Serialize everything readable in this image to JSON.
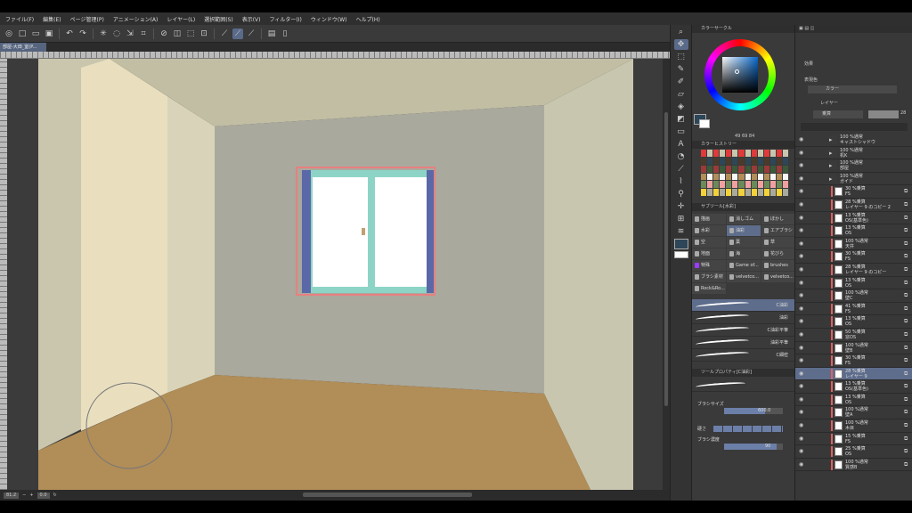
{
  "menu": [
    "ファイル(F)",
    "編集(E)",
    "ページ管理(P)",
    "アニメーション(A)",
    "レイヤー(L)",
    "選択範囲(S)",
    "表示(V)",
    "フィルター(I)",
    "ウィンドウ(W)",
    "ヘルプ(H)"
  ],
  "document_tab": "部屋-大田_室(P...",
  "status": {
    "zoom": "81.2",
    "angle": "0.0"
  },
  "panels": {
    "color_circle_title": "カラーサークル",
    "color_values": "49  69  84",
    "color_history_title": "カラーヒストリー",
    "subtool_title": "サブツール[水彩]",
    "tool_property_title": "ツールプロパティ[C油彩]",
    "effect_label": "効果",
    "display_color_label": "表現色",
    "display_color_value": "カラー",
    "layer_tab": "レイヤー",
    "blend_mode": "乗算",
    "opacity": "28"
  },
  "subtool_tabs": [
    "描画",
    "消しゴム",
    "ぼかし",
    "水彩",
    "油彩",
    "エアブラシ",
    "空",
    "葉",
    "草",
    "地面",
    "海",
    "花びら",
    "特殊",
    "Game of...",
    "brushes",
    "ブラシ素材",
    "velvetco...",
    "velvetco...",
    "Rock&Ro..."
  ],
  "brushes": [
    "C油彩",
    "油彩",
    "C油彩平筆",
    "油彩平筆",
    "C細密"
  ],
  "tool_props": {
    "brush_size_label": "ブラシサイズ",
    "brush_size_value": "600.0",
    "hardness_label": "硬さ",
    "density_label": "ブラシ濃度",
    "density_value": "90"
  },
  "layers": [
    {
      "folder": true,
      "l1": "100 %通常",
      "l2": "キャストシャドウ"
    },
    {
      "folder": true,
      "l1": "100 %通常",
      "l2": "机K"
    },
    {
      "folder": true,
      "l1": "100 %通常",
      "l2": "部屋"
    },
    {
      "folder": true,
      "l1": "100 %通常",
      "l2": "ガイド"
    },
    {
      "l1": "30 %乗算",
      "l2": "FS"
    },
    {
      "l1": "28 %乗算",
      "l2": "レイヤー 9 のコピー 2"
    },
    {
      "l1": "13 %乗算",
      "l2": "OS(基準色)"
    },
    {
      "l1": "13 %乗算",
      "l2": "OS"
    },
    {
      "l1": "100 %通常",
      "l2": "天井"
    },
    {
      "l1": "30 %乗算",
      "l2": "FS"
    },
    {
      "l1": "28 %乗算",
      "l2": "レイヤー 9 のコピー"
    },
    {
      "l1": "13 %乗算",
      "l2": "OS"
    },
    {
      "l1": "100 %通常",
      "l2": "壁C"
    },
    {
      "l1": "41 %乗算",
      "l2": "FS"
    },
    {
      "l1": "13 %乗算",
      "l2": "OS"
    },
    {
      "l1": "50 %乗算",
      "l2": "窓OS"
    },
    {
      "l1": "100 %通常",
      "l2": "壁B"
    },
    {
      "l1": "30 %乗算",
      "l2": "FS"
    },
    {
      "l1": "28 %乗算",
      "l2": "レイヤー 9",
      "sel": true
    },
    {
      "l1": "13 %乗算",
      "l2": "OS(基準色)"
    },
    {
      "l1": "13 %乗算",
      "l2": "OS"
    },
    {
      "l1": "100 %通常",
      "l2": "壁A"
    },
    {
      "l1": "100 %通常",
      "l2": "木目"
    },
    {
      "l1": "15 %乗算",
      "l2": "FS"
    },
    {
      "l1": "25 %乗算",
      "l2": "OS"
    },
    {
      "l1": "100 %通常",
      "l2": "質感B"
    }
  ],
  "colors": {
    "wall_left": "#c9c6ad",
    "wall_back": "#a9a99d",
    "wall_right": "#c8c6ae",
    "ceiling": "#c1bea4",
    "floor": "#b18d57",
    "pillar": "#e9dfbf",
    "window_frame": "#8dd4c6",
    "selection": "#6b7fa8"
  }
}
